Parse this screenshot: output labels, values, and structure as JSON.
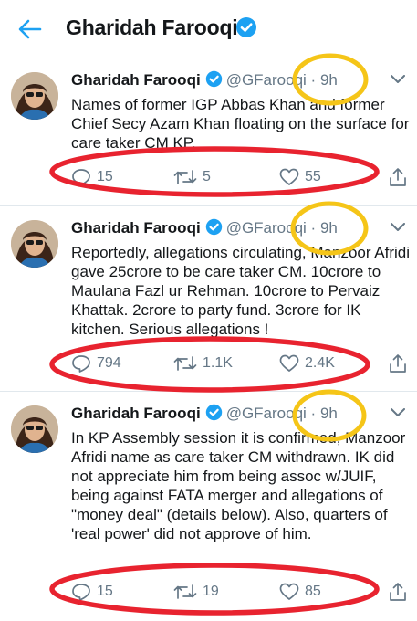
{
  "header": {
    "title": "Gharidah Farooqi",
    "back_icon": "back-arrow-icon",
    "badge_icon": "verified-badge-icon",
    "accent_color": "#1da1f2"
  },
  "tweets": [
    {
      "name": "Gharidah Farooqi",
      "handle": "@GFarooqi",
      "dot": "·",
      "time": "9h",
      "text": "Names of former IGP Abbas Khan and former Chief Secy Azam Khan floating on the surface for care taker CM KP.",
      "replies": "15",
      "retweets": "5",
      "likes": "55"
    },
    {
      "name": "Gharidah Farooqi",
      "handle": "@GFarooqi",
      "dot": "·",
      "time": "9h",
      "text": "Reportedly, allegations circulating, Manzoor Afridi gave 25crore to be care taker CM. 10crore to Maulana Fazl ur Rehman. 10crore to Pervaiz Khattak. 2crore to party fund. 3crore for IK kitchen. Serious allegations !",
      "replies": "794",
      "retweets": "1.1K",
      "likes": "2.4K"
    },
    {
      "name": "Gharidah Farooqi",
      "handle": "@GFarooqi",
      "dot": "·",
      "time": "9h",
      "text": "In KP Assembly session it is confirmed, Manzoor Afridi name as care taker CM withdrawn. IK did not appreciate him from being assoc w/JUIF, being against FATA merger and allegations of \"money deal\" (details below). Also, quarters of 'real power' did not approve of him.",
      "replies": "15",
      "retweets": "19",
      "likes": "85"
    }
  ],
  "icons": {
    "reply": "reply-icon",
    "retweet": "retweet-icon",
    "like": "heart-icon",
    "share": "share-icon",
    "more": "chevron-down-icon"
  },
  "annotation_colors": {
    "time_circle": "#f5c518",
    "actions_oval": "#e8232f"
  }
}
